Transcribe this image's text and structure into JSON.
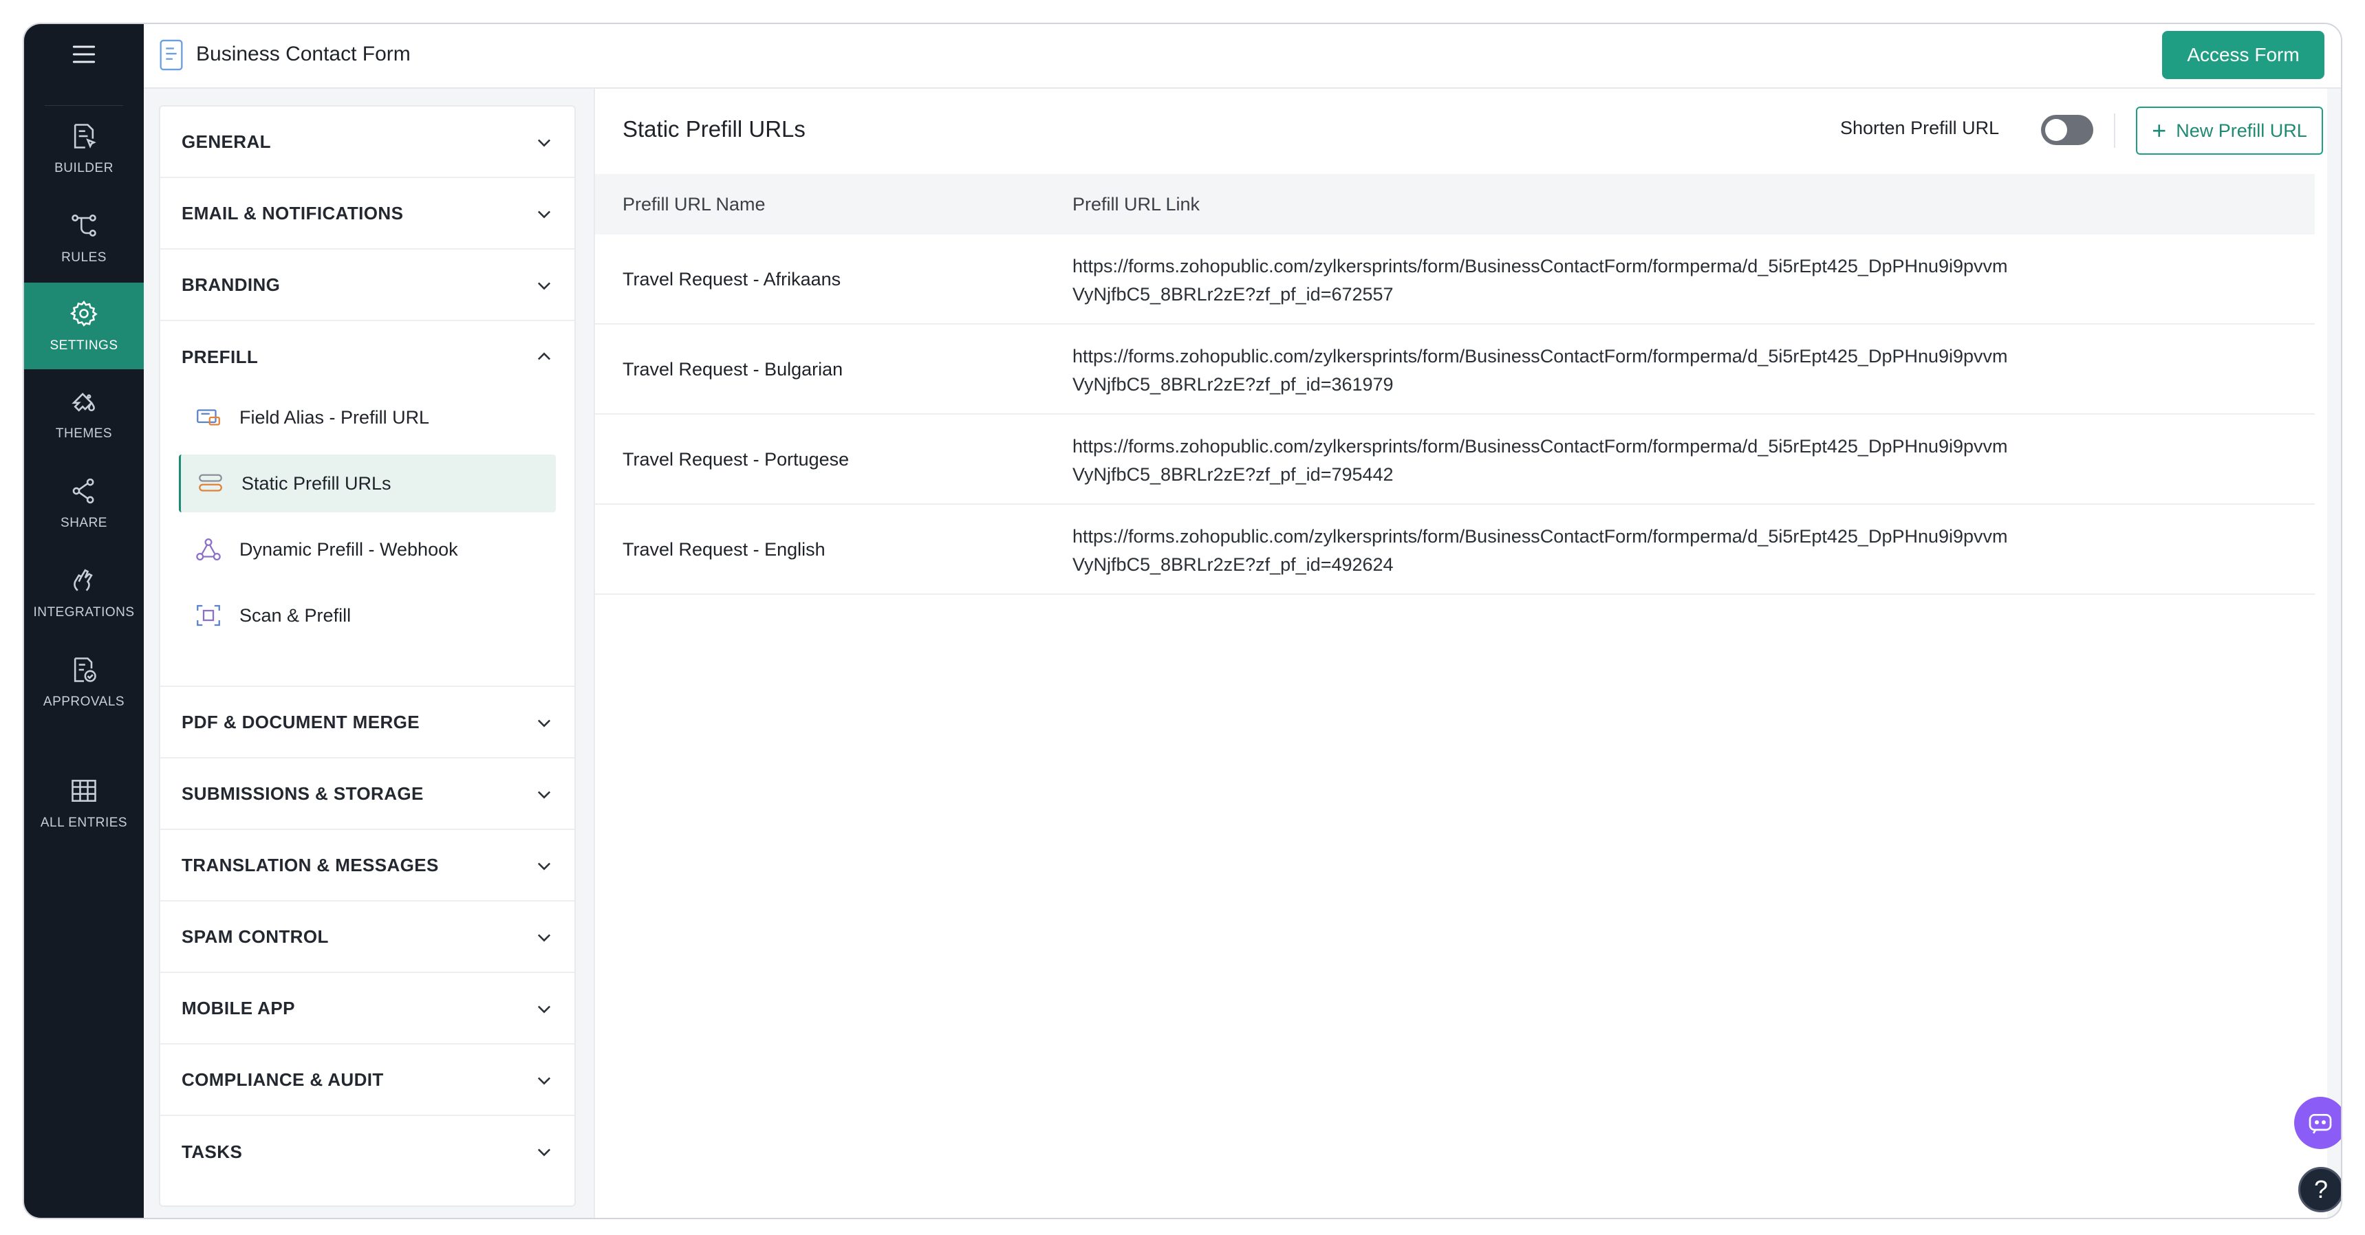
{
  "window": {
    "title": "Business Contact Form"
  },
  "header": {
    "access_button": "Access Form"
  },
  "rail": {
    "items": [
      {
        "label": "BUILDER",
        "icon": "builder-icon"
      },
      {
        "label": "RULES",
        "icon": "rules-icon"
      },
      {
        "label": "SETTINGS",
        "icon": "gear-icon",
        "active": true
      },
      {
        "label": "THEMES",
        "icon": "themes-icon"
      },
      {
        "label": "SHARE",
        "icon": "share-icon"
      },
      {
        "label": "INTEGRATIONS",
        "icon": "integrations-icon"
      },
      {
        "label": "APPROVALS",
        "icon": "approvals-icon"
      },
      {
        "label": "ALL ENTRIES",
        "icon": "table-icon"
      }
    ]
  },
  "settings": {
    "sections": [
      "GENERAL",
      "EMAIL & NOTIFICATIONS",
      "BRANDING",
      "PREFILL",
      "PDF & DOCUMENT MERGE",
      "SUBMISSIONS & STORAGE",
      "TRANSLATION & MESSAGES",
      "SPAM CONTROL",
      "MOBILE APP",
      "COMPLIANCE & AUDIT",
      "TASKS"
    ],
    "prefill_items": [
      "Field Alias - Prefill URL",
      "Static Prefill URLs",
      "Dynamic Prefill - Webhook",
      "Scan & Prefill"
    ],
    "expanded_section": "PREFILL",
    "selected_item": "Static Prefill URLs"
  },
  "main": {
    "heading": "Static Prefill URLs",
    "shorten_label": "Shorten Prefill URL",
    "shorten_enabled": false,
    "new_button": "New Prefill URL",
    "columns": [
      "Prefill URL Name",
      "Prefill URL Link"
    ],
    "rows": [
      {
        "name": "Travel Request - Afrikaans",
        "url_line1": "https://forms.zohopublic.com/zylkersprints/form/BusinessContactForm/formperma/d_5i5rEpt425_DpPHnu9i9pvvm",
        "url_line2": "VyNjfbC5_8BRLr2zE?zf_pf_id=672557"
      },
      {
        "name": "Travel Request - Bulgarian",
        "url_line1": "https://forms.zohopublic.com/zylkersprints/form/BusinessContactForm/formperma/d_5i5rEpt425_DpPHnu9i9pvvm",
        "url_line2": "VyNjfbC5_8BRLr2zE?zf_pf_id=361979"
      },
      {
        "name": "Travel Request - Portugese",
        "url_line1": "https://forms.zohopublic.com/zylkersprints/form/BusinessContactForm/formperma/d_5i5rEpt425_DpPHnu9i9pvvm",
        "url_line2": "VyNjfbC5_8BRLr2zE?zf_pf_id=795442"
      },
      {
        "name": "Travel Request - English",
        "url_line1": "https://forms.zohopublic.com/zylkersprints/form/BusinessContactForm/formperma/d_5i5rEpt425_DpPHnu9i9pvvm",
        "url_line2": "VyNjfbC5_8BRLr2zE?zf_pf_id=492624"
      }
    ]
  },
  "floating": {
    "help_label": "?"
  },
  "colors": {
    "accent": "#1f9e83",
    "rail_bg": "#141a24",
    "chat_fab": "#8b5cf6"
  }
}
